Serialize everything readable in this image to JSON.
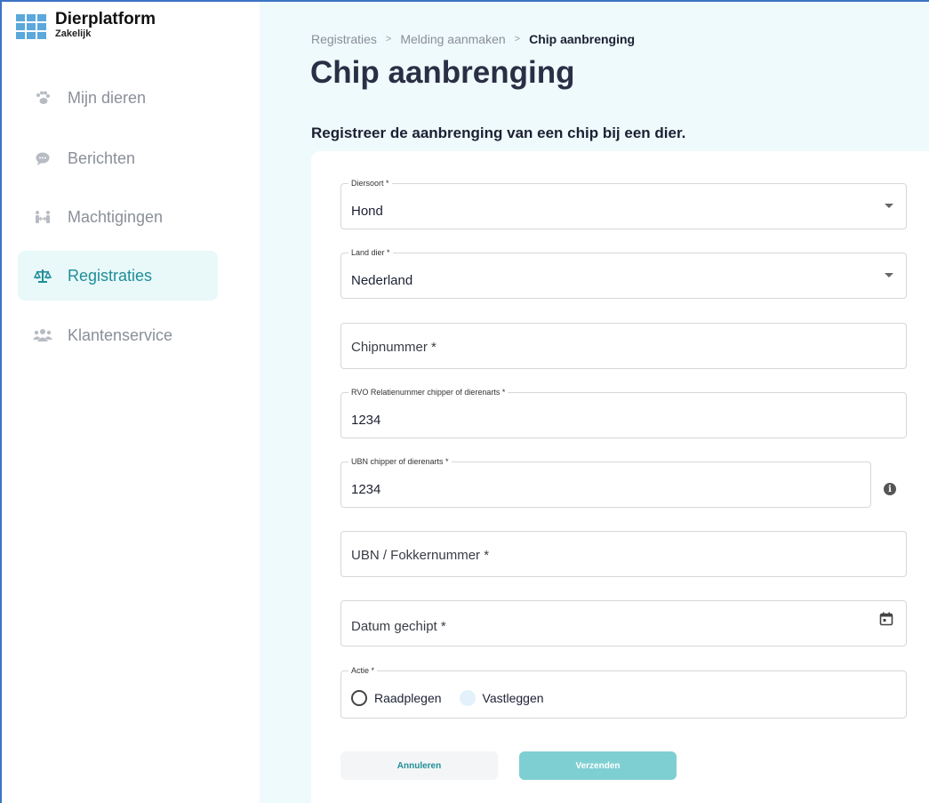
{
  "app": {
    "name": "Dierplatform",
    "subtitle": "Zakelijk"
  },
  "sidebar": {
    "items": [
      {
        "label": "Mijn dieren",
        "icon": "paw-icon",
        "active": false
      },
      {
        "label": "Berichten",
        "icon": "chat-bubble-icon",
        "active": false
      },
      {
        "label": "Machtigingen",
        "icon": "people-arrows-icon",
        "active": false
      },
      {
        "label": "Registraties",
        "icon": "balance-scale-icon",
        "active": true
      },
      {
        "label": "Klantenservice",
        "icon": "users-icon",
        "active": false
      }
    ]
  },
  "breadcrumb": {
    "items": [
      "Registraties",
      "Melding aanmaken",
      "Chip aanbrenging"
    ],
    "separator": ">"
  },
  "page": {
    "title": "Chip aanbrenging",
    "subtitle": "Registreer de aanbrenging van een chip bij een dier."
  },
  "form": {
    "diersoort": {
      "label": "Diersoort *",
      "value": "Hond"
    },
    "land_dier": {
      "label": "Land dier *",
      "value": "Nederland"
    },
    "chipnummer": {
      "placeholder": "Chipnummer *"
    },
    "rvo_relatienummer": {
      "label": "RVO Relatienummer chipper of dierenarts *",
      "value": "1234"
    },
    "ubn_chipper": {
      "label": "UBN chipper of dierenarts *",
      "value": "1234"
    },
    "ubn_fokker": {
      "placeholder": "UBN / Fokkernummer *"
    },
    "datum_gechipt": {
      "placeholder": "Datum gechipt *"
    },
    "actie": {
      "label": "Actie *",
      "options": [
        "Raadplegen",
        "Vastleggen"
      ]
    }
  },
  "buttons": {
    "cancel": "Annuleren",
    "submit": "Verzenden"
  },
  "colors": {
    "accent": "#1e8f98",
    "main_bg": "#eefafb",
    "submit_bg": "#7ecfd2",
    "logo": "#5aa8dc"
  }
}
